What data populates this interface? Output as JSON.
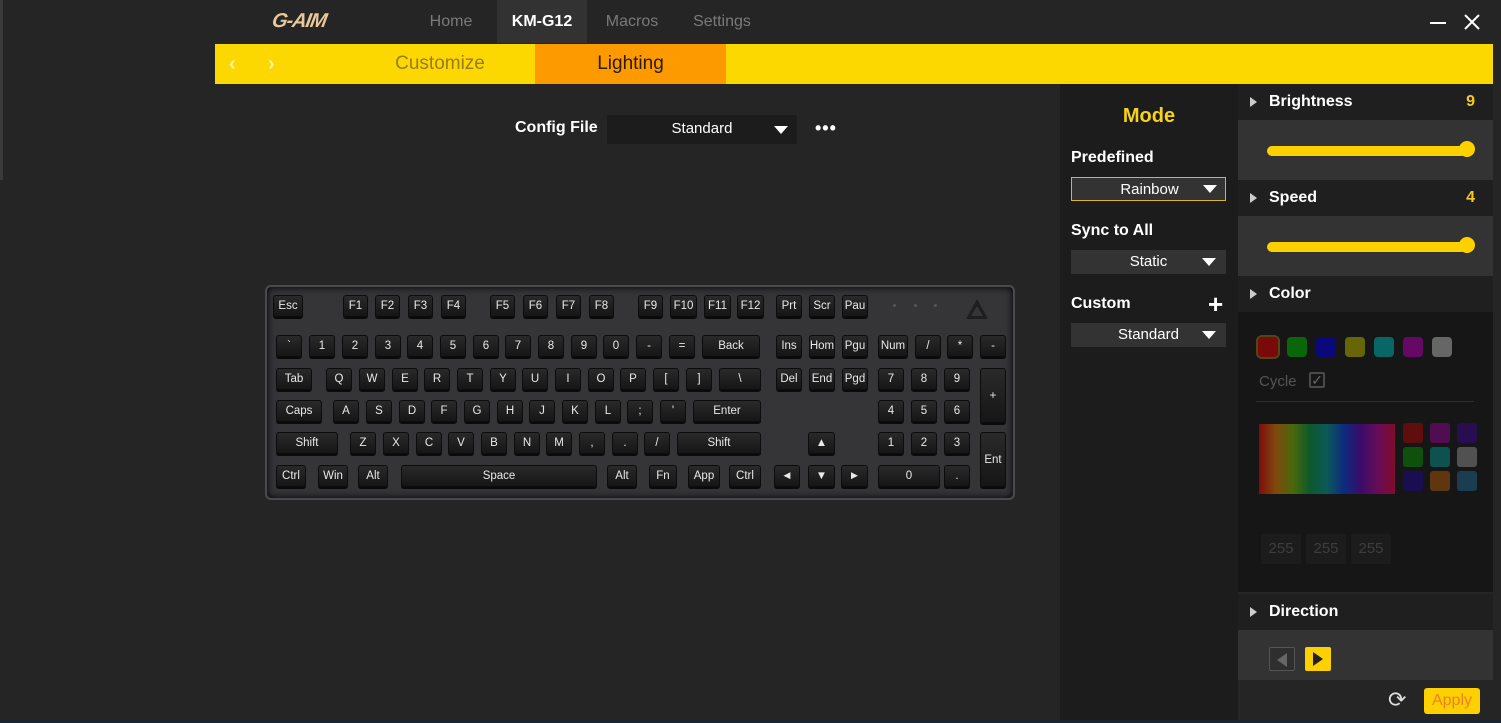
{
  "app": {
    "logo": "G-AIM",
    "nav_tabs": [
      {
        "label": "Home",
        "active": false
      },
      {
        "label": "KM-G12",
        "active": true
      },
      {
        "label": "Macros",
        "active": false
      },
      {
        "label": "Settings",
        "active": false
      }
    ],
    "window_controls": {
      "minimize": "minimize-icon",
      "close": "close-icon"
    }
  },
  "subnav": {
    "back_icon": "‹",
    "forward_icon": "›",
    "tabs": [
      {
        "label": "Customize",
        "active": false
      },
      {
        "label": "Lighting",
        "active": true
      }
    ]
  },
  "config": {
    "label": "Config File",
    "selected": "Standard",
    "more_label": "•••"
  },
  "keyboard": {
    "rows": [
      [
        "Esc",
        "F1",
        "F2",
        "F3",
        "F4",
        "F5",
        "F6",
        "F7",
        "F8",
        "F9",
        "F10",
        "F11",
        "F12",
        "Prt",
        "Scr",
        "Pau"
      ],
      [
        "`",
        "1",
        "2",
        "3",
        "4",
        "5",
        "6",
        "7",
        "8",
        "9",
        "0",
        "-",
        "=",
        "Back",
        "Ins",
        "Hom",
        "Pgu",
        "Num",
        "/",
        "*",
        "-"
      ],
      [
        "Tab",
        "Q",
        "W",
        "E",
        "R",
        "T",
        "Y",
        "U",
        "I",
        "O",
        "P",
        "[",
        "]",
        "\\",
        "Del",
        "End",
        "Pgd",
        "7",
        "8",
        "9",
        "+"
      ],
      [
        "Caps",
        "A",
        "S",
        "D",
        "F",
        "G",
        "H",
        "J",
        "K",
        "L",
        ";",
        "'",
        "Enter",
        "4",
        "5",
        "6"
      ],
      [
        "Shift",
        "Z",
        "X",
        "C",
        "V",
        "B",
        "N",
        "M",
        ",",
        ".",
        "/",
        "Shift",
        "▲",
        "1",
        "2",
        "3",
        "Ent"
      ],
      [
        "Ctrl",
        "Win",
        "Alt",
        "Space",
        "Alt",
        "Fn",
        "App",
        "Ctrl",
        "◄",
        "▼",
        "►",
        "0",
        "."
      ]
    ]
  },
  "mode": {
    "title": "Mode",
    "predefined_label": "Predefined",
    "predefined_value": "Rainbow",
    "sync_label": "Sync to All",
    "sync_value": "Static",
    "custom_label": "Custom",
    "custom_add": "+",
    "custom_value": "Standard"
  },
  "brightness": {
    "label": "Brightness",
    "value": "9",
    "level": 1.0
  },
  "speed": {
    "label": "Speed",
    "value": "4",
    "level": 1.0
  },
  "color": {
    "label": "Color",
    "swatches": [
      "#cc0000",
      "#00aa00",
      "#0000cc",
      "#aaaa00",
      "#00aaaa",
      "#aa00aa",
      "#aaaaaa"
    ],
    "selected_index": 0,
    "cycle_label": "Cycle",
    "cycle_checked": true,
    "palette": [
      "#cc0000",
      "#aa00aa",
      "#4400aa",
      "#00aa00",
      "#00aaaa",
      "#aaaaaa",
      "#2200aa",
      "#cc6600",
      "#2277aa"
    ],
    "rgb": [
      "255",
      "255",
      "255"
    ]
  },
  "direction": {
    "label": "Direction",
    "selected": "right"
  },
  "footer": {
    "reset_icon": "⟳",
    "apply_label": "Apply"
  },
  "colors": {
    "accent_yellow": "#fdd800",
    "accent_orange": "#fd9a00",
    "mode_title": "#f7d21c"
  }
}
